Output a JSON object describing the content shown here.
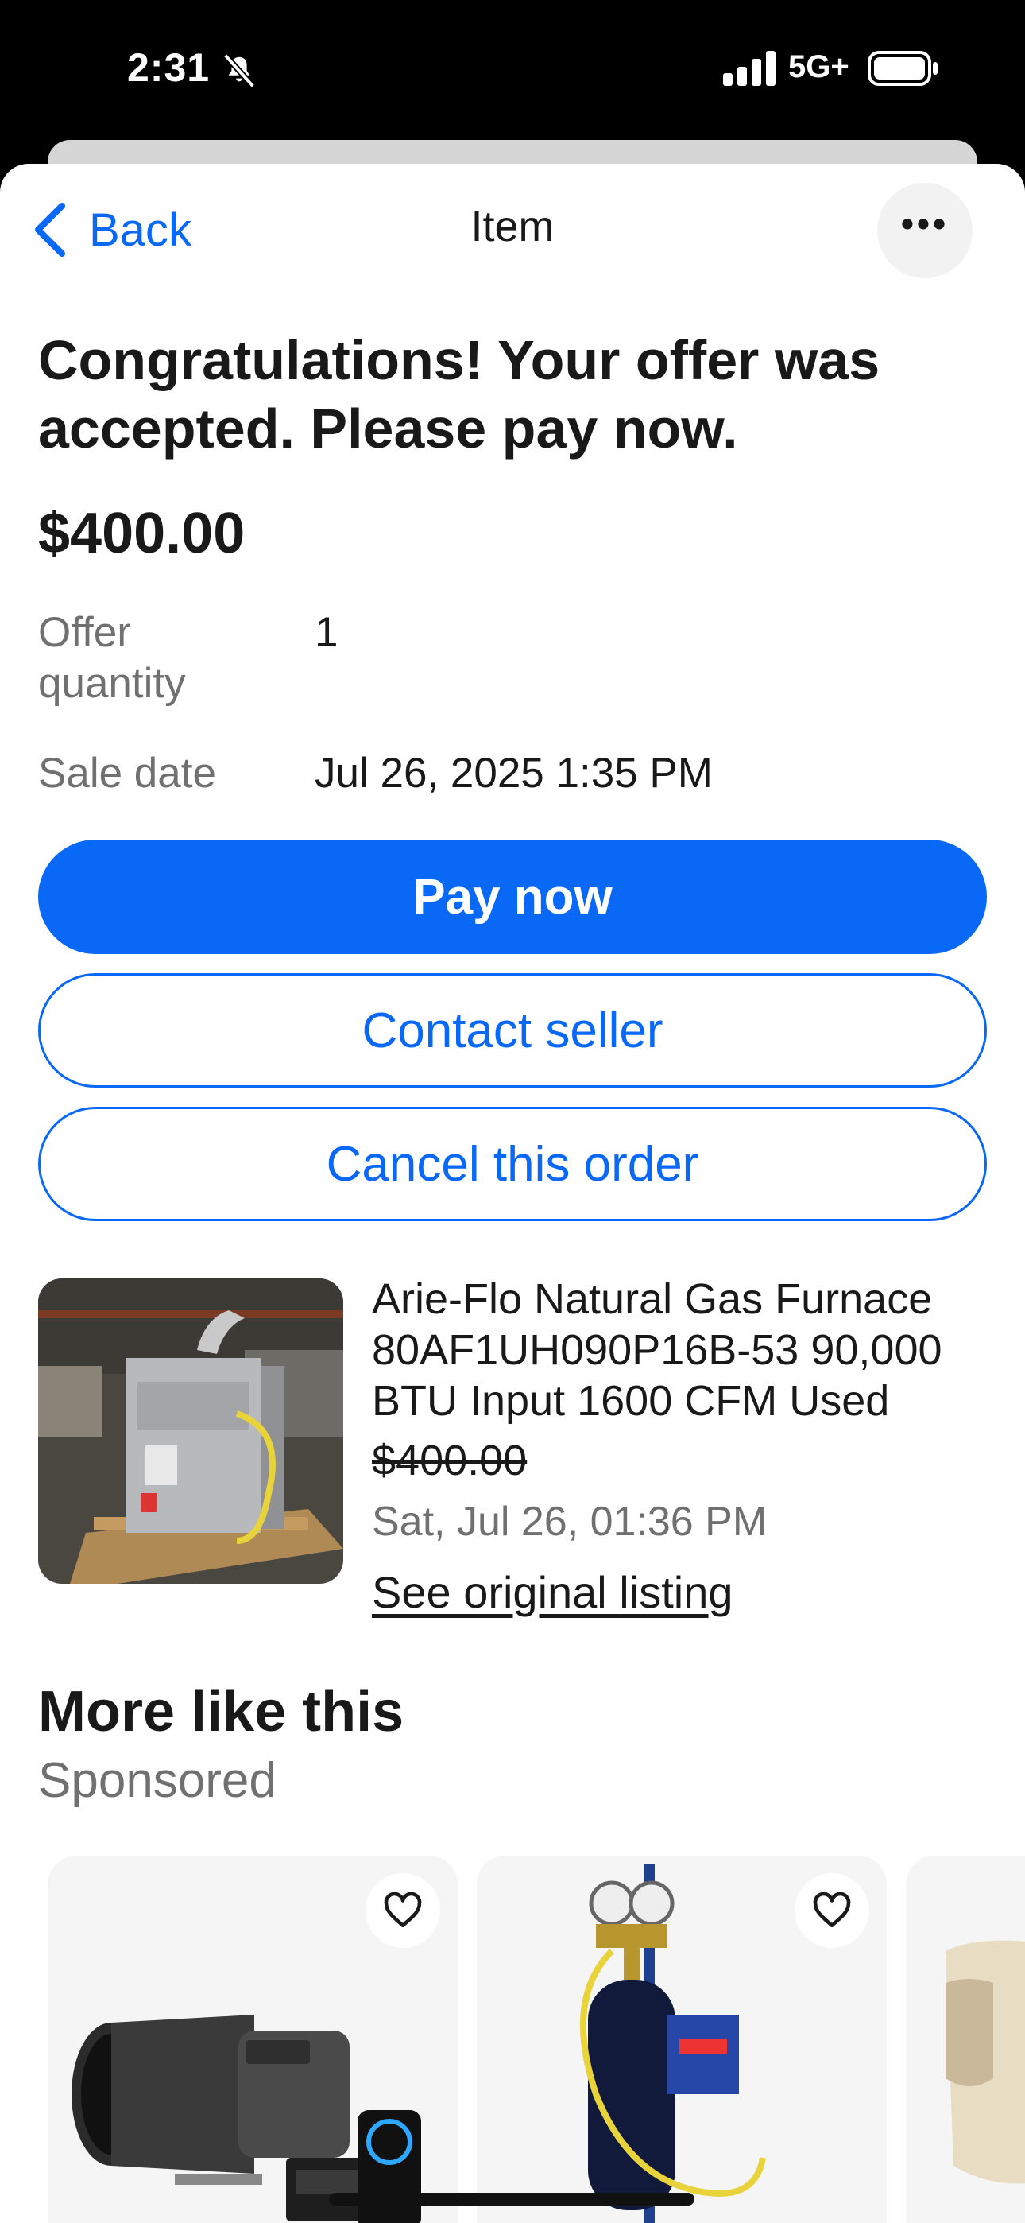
{
  "status_bar": {
    "time": "2:31",
    "network": "5G+",
    "silent_icon": "bell-slash-icon",
    "signal_icon": "cellular-signal-icon",
    "battery_icon": "battery-icon"
  },
  "nav": {
    "back_label": "Back",
    "title": "Item",
    "more_icon": "ellipsis-icon"
  },
  "offer": {
    "headline": "Congratulations! Your offer was accepted. Please pay now.",
    "price": "$400.00",
    "details": [
      {
        "label": "Offer quantity",
        "value": "1"
      },
      {
        "label": "Sale date",
        "value": "Jul 26, 2025 1:35 PM"
      }
    ]
  },
  "actions": {
    "pay_now": "Pay now",
    "contact_seller": "Contact seller",
    "cancel_order": "Cancel this order"
  },
  "item": {
    "title": "Arie-Flo Natural Gas Furnace 80AF1UH090P16B-53 90,000 BTU Input 1600 CFM Used",
    "original_price": "$400.00",
    "date": "Sat, Jul 26, 01:36 PM",
    "link": "See original listing",
    "image": "furnace-photo"
  },
  "more_like_this": {
    "title": "More like this",
    "subtitle": "Sponsored",
    "cards": [
      {
        "image": "inline-fan-with-controller-photo",
        "fav_icon": "heart-outline-icon"
      },
      {
        "image": "gas-cylinder-gauges-photo",
        "fav_icon": "heart-outline-icon"
      },
      {
        "image": "partial-product-photo",
        "fav_icon": "heart-outline-icon"
      }
    ]
  },
  "colors": {
    "accent": "#0968f6",
    "text": "#191919",
    "muted": "#707070"
  }
}
